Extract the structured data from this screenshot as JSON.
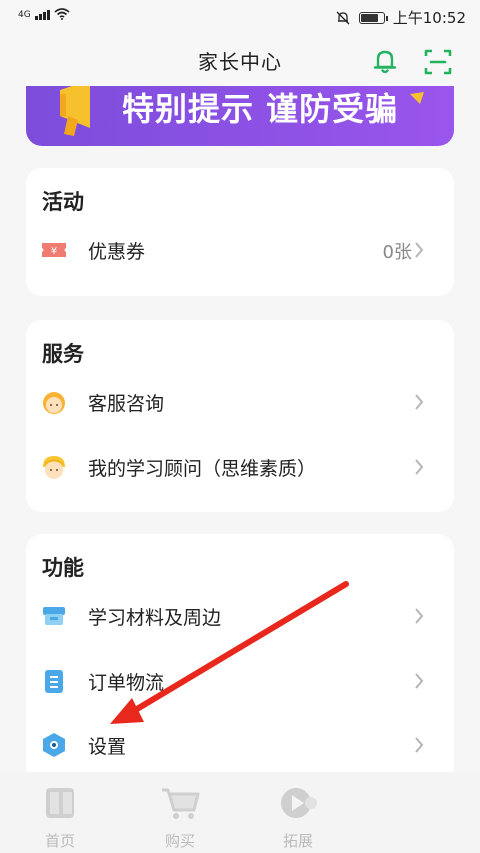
{
  "status_bar": {
    "network": "4G",
    "time": "上午10:52",
    "battery_level": 0.85
  },
  "header": {
    "title": "家长中心"
  },
  "banner": {
    "text": "特别提示 谨防受骗"
  },
  "sections": {
    "activity": {
      "title": "活动",
      "items": [
        {
          "label": "优惠券",
          "value": "0张"
        }
      ]
    },
    "service": {
      "title": "服务",
      "items": [
        {
          "label": "客服咨询"
        },
        {
          "label": "我的学习顾问（思维素质）"
        }
      ]
    },
    "features": {
      "title": "功能",
      "items": [
        {
          "label": "学习材料及周边"
        },
        {
          "label": "订单物流"
        },
        {
          "label": "设置"
        }
      ]
    }
  },
  "tabbar": {
    "tabs": [
      {
        "label": "首页"
      },
      {
        "label": "购买"
      },
      {
        "label": "拓展"
      }
    ]
  },
  "colors": {
    "accent_green": "#23b35f",
    "banner_purple": "#8a50e6",
    "annotation_red": "#e8271d"
  }
}
